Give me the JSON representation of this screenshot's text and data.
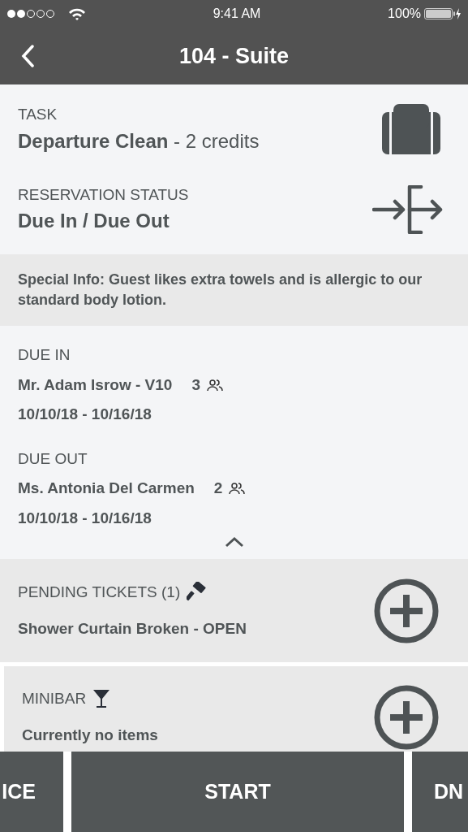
{
  "status_bar": {
    "time": "9:41 AM",
    "battery": "100%"
  },
  "nav": {
    "title": "104 - Suite"
  },
  "task": {
    "label": "TASK",
    "value": "**Departure Clean** - 2 credits"
  },
  "reservation": {
    "label": "RESERVATION STATUS",
    "value": "Due In / Due Out"
  },
  "special_info": "Special Info: Guest likes extra towels and is allergic to our standard body lotion.",
  "guests": [
    {
      "label": "DUE IN",
      "name": "Mr. Adam Isrow - V10",
      "count": "3",
      "dates": "10/10/18 - 10/16/18"
    },
    {
      "label": "DUE OUT",
      "name": "Ms. Antonia Del Carmen",
      "count": "2",
      "dates": "10/10/18 - 10/16/18"
    }
  ],
  "guests_expanded": true,
  "pending_tickets": {
    "title": "PENDING TICKETS (1)",
    "item": "Shower Curtain Broken - OPEN"
  },
  "minibar": {
    "title": "MINIBAR",
    "item": "Currently no items"
  },
  "actions": [
    {
      "label": "ICE"
    },
    {
      "label": "START"
    },
    {
      "label": "DN"
    }
  ]
}
